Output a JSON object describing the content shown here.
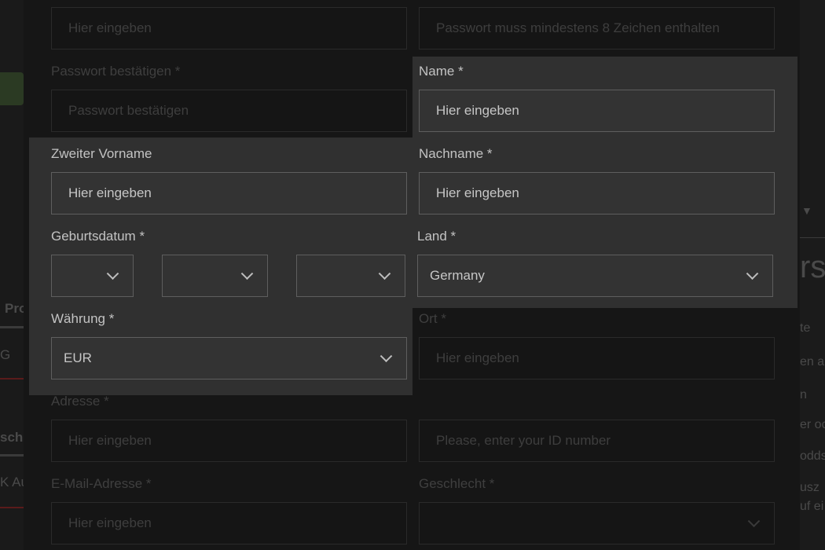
{
  "background": {
    "left_tab_label": "Pro",
    "left_snippet_g": "G",
    "left_snippet_sch": "sch",
    "left_snippet_au": "K Au",
    "right_heading": "rsc",
    "right_lines": [
      "te",
      "en a",
      "n",
      "er oc",
      "odds",
      "usz",
      "uf ei"
    ],
    "right_arrow": "▼"
  },
  "form": {
    "top_left_placeholder": "Hier eingeben",
    "top_right_placeholder": "Passwort muss mindestens 8 Zeichen enthalten",
    "confirm_password": {
      "label": "Passwort bestätigen *",
      "placeholder": "Passwort bestätigen"
    },
    "name": {
      "label": "Name *",
      "placeholder": "Hier eingeben"
    },
    "middle_name": {
      "label": "Zweiter Vorname",
      "placeholder": "Hier eingeben"
    },
    "last_name": {
      "label": "Nachname *",
      "placeholder": "Hier eingeben"
    },
    "birthdate": {
      "label": "Geburtsdatum *",
      "day": "",
      "month": "",
      "year": ""
    },
    "country": {
      "label": "Land *",
      "value": "Germany"
    },
    "currency": {
      "label": "Währung *",
      "value": "EUR"
    },
    "city": {
      "label": "Ort *",
      "placeholder": "Hier eingeben"
    },
    "address": {
      "label": "Adresse *",
      "placeholder": "Hier eingeben"
    },
    "id_number": {
      "placeholder": "Please, enter your ID number"
    },
    "email": {
      "label": "E-Mail-Adresse *",
      "placeholder": "Hier eingeben"
    },
    "gender": {
      "label": "Geschlecht *",
      "value": ""
    }
  }
}
